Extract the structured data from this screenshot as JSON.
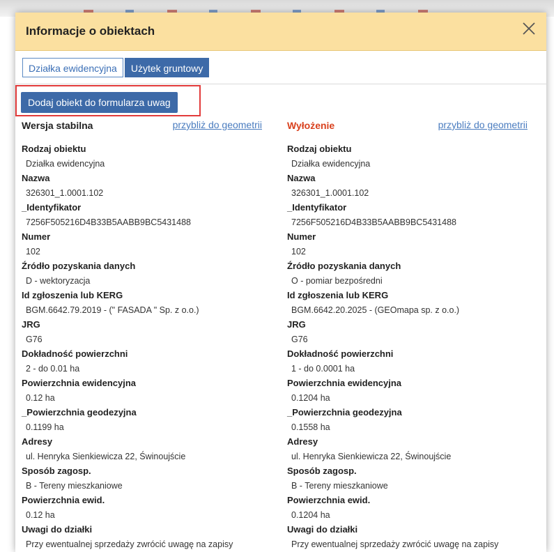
{
  "dialog": {
    "title": "Informacje o obiektach",
    "close_icon": "close-icon"
  },
  "tabs": [
    {
      "label": "Działka ewidencyjna",
      "active": false
    },
    {
      "label": "Użytek gruntowy",
      "active": true
    }
  ],
  "add_button": "Dodaj obiekt do formularza uwag",
  "zoom_link": "przybliż do geometrii",
  "columns": {
    "stable": {
      "title": "Wersja stabilna",
      "fields": [
        {
          "label": "Rodzaj obiektu",
          "value": "Działka ewidencyjna"
        },
        {
          "label": "Nazwa",
          "value": "326301_1.0001.102"
        },
        {
          "label": "_Identyfikator",
          "value": "7256F505216D4B33B5AABB9BC5431488"
        },
        {
          "label": "Numer",
          "value": "102"
        },
        {
          "label": "Źródło pozyskania danych",
          "value": "D - wektoryzacja"
        },
        {
          "label": "Id zgłoszenia lub KERG",
          "value": "BGM.6642.79.2019 - (\" FASADA \" Sp. z o.o.)"
        },
        {
          "label": "JRG",
          "value": "G76"
        },
        {
          "label": "Dokładność powierzchni",
          "value": "2 - do 0.01 ha"
        },
        {
          "label": "Powierzchnia ewidencyjna",
          "value": "0.12 ha"
        },
        {
          "label": "_Powierzchnia geodezyjna",
          "value": "0.1199 ha"
        },
        {
          "label": "Adresy",
          "value": "ul. Henryka Sienkiewicza 22, Świnoujście"
        },
        {
          "label": "Sposób zagosp.",
          "value": "B - Tereny mieszkaniowe"
        },
        {
          "label": "Powierzchnia ewid.",
          "value": "0.12 ha"
        },
        {
          "label": "Uwagi do działki",
          "value": "Przy ewentualnej sprzedaży zwrócić uwagę na zapisy"
        }
      ]
    },
    "exposure": {
      "title": "Wyłożenie",
      "title_color": "#d9411e",
      "fields": [
        {
          "label": "Rodzaj obiektu",
          "value": "Działka ewidencyjna"
        },
        {
          "label": "Nazwa",
          "value": "326301_1.0001.102"
        },
        {
          "label": "_Identyfikator",
          "value": "7256F505216D4B33B5AABB9BC5431488"
        },
        {
          "label": "Numer",
          "value": "102"
        },
        {
          "label": "Źródło pozyskania danych",
          "value": "O - pomiar bezpośredni"
        },
        {
          "label": "Id zgłoszenia lub KERG",
          "value": "BGM.6642.20.2025 - (GEOmapa sp. z o.o.)"
        },
        {
          "label": "JRG",
          "value": "G76"
        },
        {
          "label": "Dokładność powierzchni",
          "value": "1 - do 0.0001 ha"
        },
        {
          "label": "Powierzchnia ewidencyjna",
          "value": "0.1204 ha"
        },
        {
          "label": "_Powierzchnia geodezyjna",
          "value": "0.1558 ha"
        },
        {
          "label": "Adresy",
          "value": "ul. Henryka Sienkiewicza 22, Świnoujście"
        },
        {
          "label": "Sposób zagosp.",
          "value": "B - Tereny mieszkaniowe"
        },
        {
          "label": "Powierzchnia ewid.",
          "value": "0.1204 ha"
        },
        {
          "label": "Uwagi do działki",
          "value": "Przy ewentualnej sprzedaży zwrócić uwagę na zapisy"
        }
      ]
    }
  }
}
